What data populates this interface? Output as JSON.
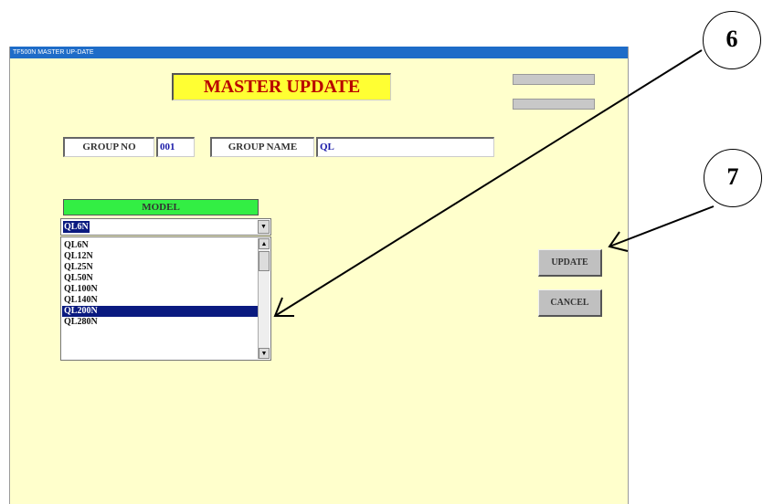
{
  "window": {
    "title": "TF500N MASTER UP-DATE"
  },
  "header": {
    "title": "MASTER UPDATE"
  },
  "group": {
    "no_label": "GROUP NO",
    "no_value": "001",
    "name_label": "GROUP NAME",
    "name_value": "QL"
  },
  "model": {
    "header": "MODEL",
    "selected": "QL6N",
    "items": [
      "QL6N",
      "QL12N",
      "QL25N",
      "QL50N",
      "QL100N",
      "QL140N",
      "QL200N",
      "QL280N"
    ],
    "highlighted_item": "QL200N"
  },
  "actions": {
    "update_label": "UPDATE",
    "cancel_label": "CANCEL"
  },
  "callouts": {
    "c6": "6",
    "c7": "7"
  },
  "colors": {
    "titlebar": "#1e6cc8",
    "background": "#ffffcc",
    "title_bg": "#ffff33",
    "title_text": "#b80000",
    "model_header": "#33ee44",
    "selection": "#0a1a80",
    "value_text": "#1a1aa8"
  }
}
